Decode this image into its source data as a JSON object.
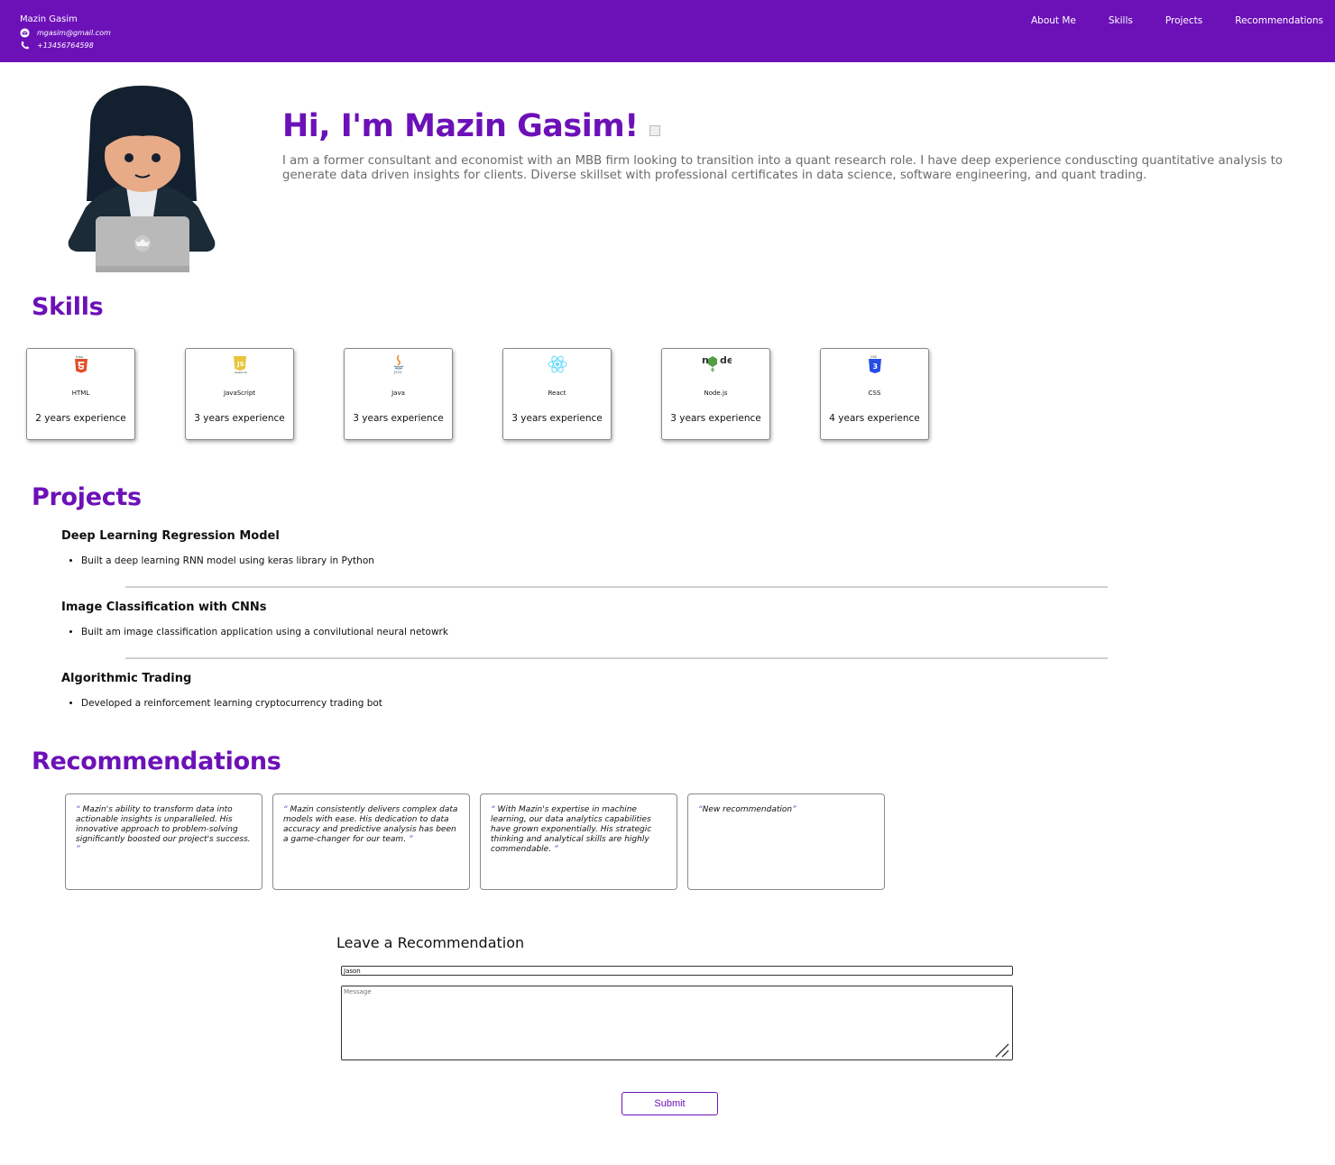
{
  "header": {
    "name": "Mazin Gasim",
    "email": "mgasim@gmail.com",
    "phone": "+13456764598",
    "nav": [
      "About Me",
      "Skills",
      "Projects",
      "Recommendations"
    ],
    "bg_color": "#6c11b8"
  },
  "hero": {
    "title": "Hi, I'm Mazin Gasim!",
    "intro": "I am a former consultant and economist with an MBB firm looking to transition into a quant research role. I have deep experience conduscting quantitative analysis to generate data driven insights for clients. Diverse skillset with professional certificates in data science, software engineering, and quant trading."
  },
  "skills": {
    "title": "Skills",
    "items": [
      {
        "name": "HTML",
        "experience": "2 years experience",
        "icon": "html5-icon"
      },
      {
        "name": "JavaScript",
        "experience": "3 years experience",
        "icon": "javascript-icon"
      },
      {
        "name": "Java",
        "experience": "3 years experience",
        "icon": "java-icon"
      },
      {
        "name": "React",
        "experience": "3 years experience",
        "icon": "react-icon"
      },
      {
        "name": "Node.js",
        "experience": "3 years experience",
        "icon": "nodejs-icon"
      },
      {
        "name": "CSS",
        "experience": "4 years experience",
        "icon": "css3-icon"
      }
    ]
  },
  "projects": {
    "title": "Projects",
    "items": [
      {
        "name": "Deep Learning Regression Model",
        "bullet": "Built a deep learning RNN model using keras library in Python"
      },
      {
        "name": "Image Classification with CNNs",
        "bullet": "Built am image classification application using a convilutional neural netowrk"
      },
      {
        "name": "Algorithmic Trading",
        "bullet": "Developed a reinforcement learning cryptocurrency trading bot"
      }
    ]
  },
  "recommendations": {
    "title": "Recommendations",
    "items": [
      "Mazin's ability to transform data into actionable insights is unparalleled. His innovative approach to problem-solving significantly boosted our project's success.",
      "Mazin consistently delivers complex data models with ease. His dedication to data accuracy and predictive analysis has been a game-changer for our team.",
      "With Mazin's expertise in machine learning, our data analytics capabilities have grown exponentially. His strategic thinking and analytical skills are highly commendable.",
      "New recommendation"
    ]
  },
  "form": {
    "title": "Leave a Recommendation",
    "name_value": "Jason",
    "message_placeholder": "Message",
    "submit_label": "Submit"
  },
  "hero_logo_icon": "laptop-apple-icon",
  "accent_color": "#6c11b8"
}
